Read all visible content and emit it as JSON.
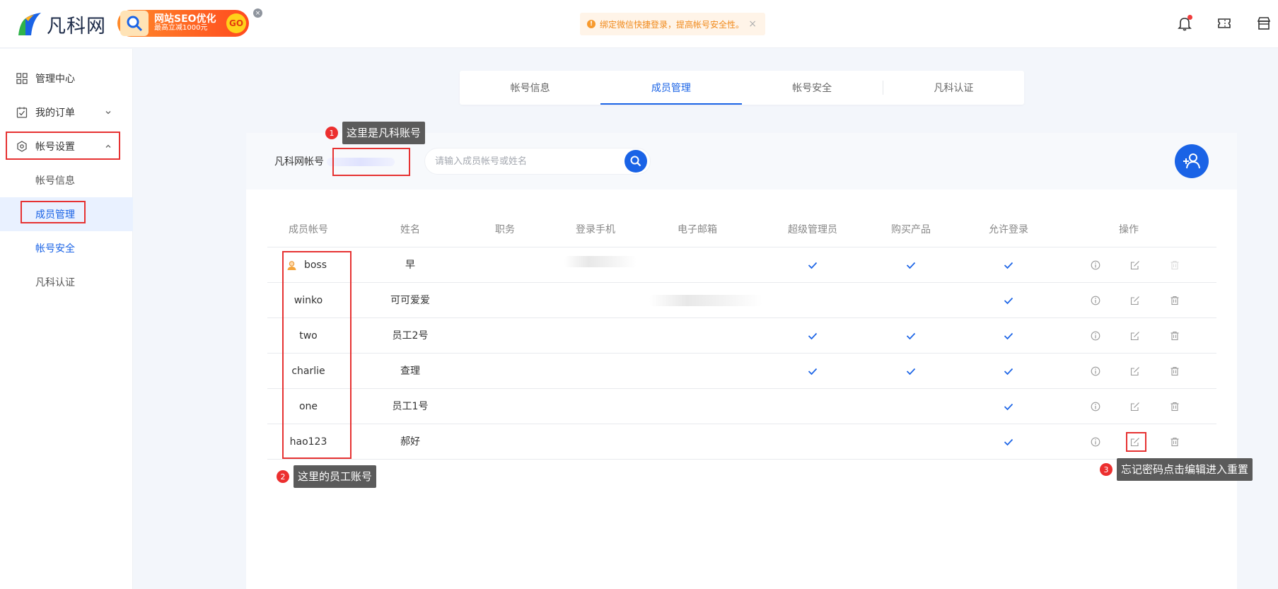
{
  "header": {
    "logo_text": "凡科网",
    "ad": {
      "title": "网站SEO优化",
      "subtitle": "最高立减1000元",
      "go": "GO",
      "close": "×"
    },
    "notice": {
      "icon": "!",
      "text": "绑定微信快捷登录，提高帐号安全性。",
      "close": "×"
    },
    "icons": [
      "bell-icon",
      "ticket-icon",
      "store-icon"
    ]
  },
  "sidebar": {
    "items": [
      {
        "label": "管理中心",
        "icon": "grid-icon"
      },
      {
        "label": "我的订单",
        "icon": "order-icon"
      },
      {
        "label": "帐号设置",
        "icon": "settings-icon"
      }
    ],
    "subitems": [
      "帐号信息",
      "成员管理",
      "帐号安全",
      "凡科认证"
    ]
  },
  "tabs": [
    "帐号信息",
    "成员管理",
    "帐号安全",
    "凡科认证"
  ],
  "toolbar": {
    "account_label": "凡科网帐号",
    "search_placeholder": "请输入成员帐号或姓名"
  },
  "table": {
    "headers": [
      "成员帐号",
      "姓名",
      "职务",
      "登录手机",
      "电子邮箱",
      "超级管理员",
      "购买产品",
      "允许登录",
      "操作"
    ],
    "rows": [
      {
        "account": "boss",
        "name": "早",
        "super": true,
        "buy": true,
        "login": true,
        "owner": true
      },
      {
        "account": "winko",
        "name": "可可爱爱",
        "super": false,
        "buy": false,
        "login": true
      },
      {
        "account": "two",
        "name": "员工2号",
        "super": true,
        "buy": true,
        "login": true
      },
      {
        "account": "charlie",
        "name": "查理",
        "super": true,
        "buy": true,
        "login": true
      },
      {
        "account": "one",
        "name": "员工1号",
        "super": false,
        "buy": false,
        "login": true
      },
      {
        "account": "hao123",
        "name": "郝好",
        "super": false,
        "buy": false,
        "login": true
      }
    ]
  },
  "callouts": [
    {
      "num": "1",
      "text": "这里是凡科账号"
    },
    {
      "num": "2",
      "text": "这里的员工账号"
    },
    {
      "num": "3",
      "text": "忘记密码点击编辑进入重置"
    }
  ],
  "colors": {
    "accent": "#1a63e6",
    "highlight": "#e63232"
  }
}
